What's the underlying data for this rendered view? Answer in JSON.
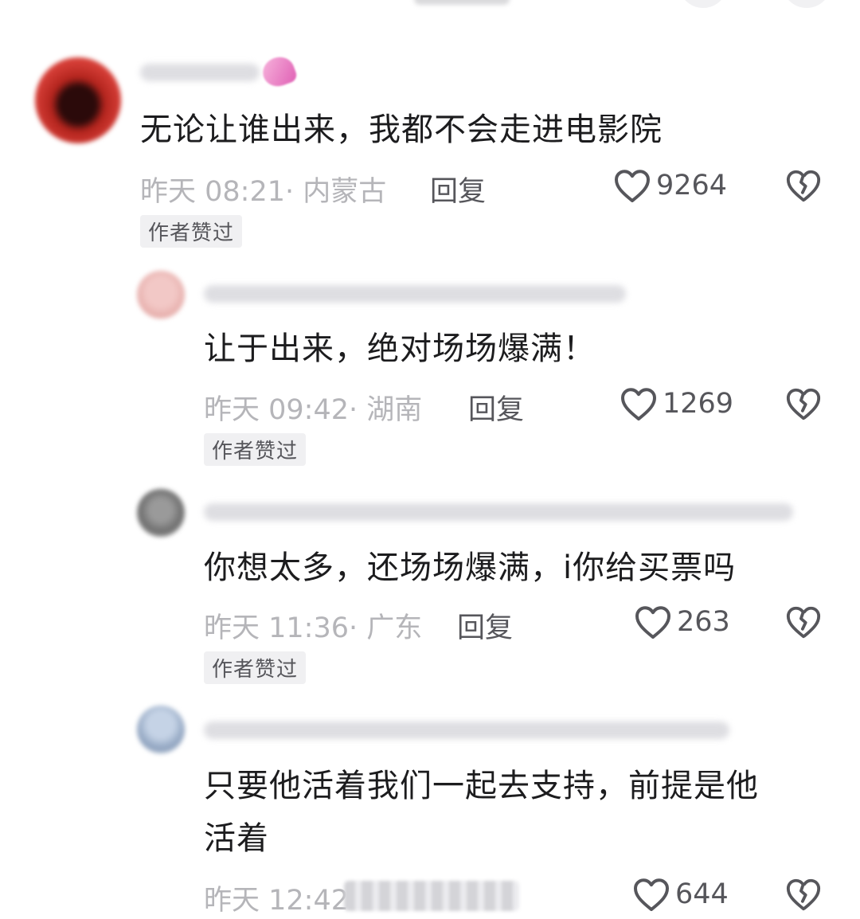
{
  "comments": [
    {
      "text_lines": [
        "无论让谁出来，我都不会走进电影院"
      ],
      "time": "昨天 08:21",
      "location": "内蒙古",
      "reply_label": "回复",
      "likes": "9264",
      "badge": "作者赞过"
    },
    {
      "text_lines": [
        "让于出来，绝对场场爆满！"
      ],
      "time": "昨天 09:42",
      "location": "湖南",
      "reply_label": "回复",
      "likes": "1269",
      "badge": "作者赞过"
    },
    {
      "text_lines": [
        "你想太多，还场场爆满，i你给买票吗"
      ],
      "time": "昨天 11:36",
      "location": "广东",
      "reply_label": "回复",
      "likes": "263",
      "badge": "作者赞过"
    },
    {
      "text_lines": [
        "只要他活着我们一起去支持，前提是他",
        "活着"
      ],
      "time": "昨天 12:42",
      "likes": "644"
    }
  ],
  "icons": {
    "like": "heart-outline-icon",
    "dislike": "broken-heart-icon"
  },
  "colors": {
    "text_primary": "#1c1c1e",
    "text_meta": "#b5b5b9",
    "text_action": "#56565b",
    "badge_bg": "#f0f0f2"
  }
}
